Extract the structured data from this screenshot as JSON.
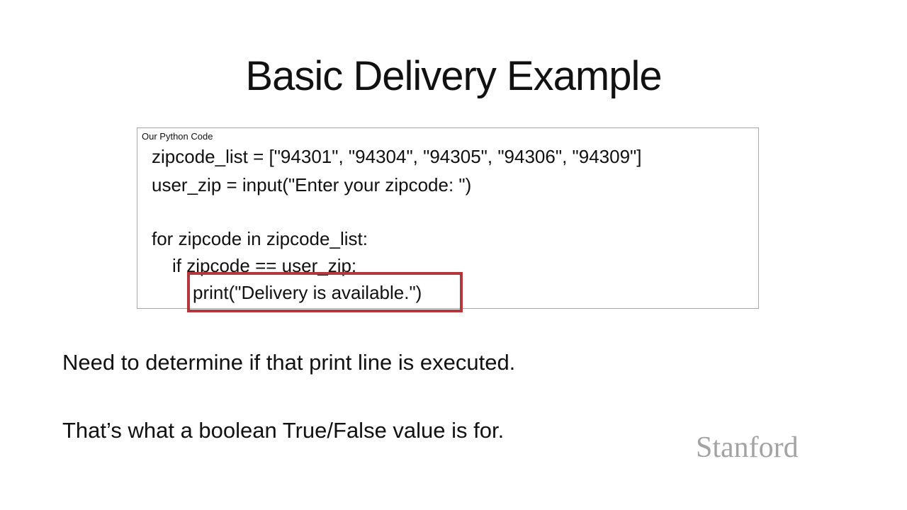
{
  "slide": {
    "title": "Basic Delivery Example"
  },
  "code_panel": {
    "label": "Our Python Code",
    "lines": [
      "zipcode_list = [\"94301\", \"94304\", \"94305\", \"94306\", \"94309\"]",
      "user_zip = input(\"Enter your zipcode: \")",
      "for zipcode in zipcode_list:",
      "if zipcode == user_zip:",
      "print(\"Delivery is available.\")"
    ]
  },
  "notes": [
    "Need to determine if that print line is executed.",
    "That’s what a boolean True/False value is for."
  ],
  "branding": {
    "logo_text": "Stanford"
  },
  "colors": {
    "highlight_border": "#b4373d",
    "logo": "#a3a3a3"
  }
}
